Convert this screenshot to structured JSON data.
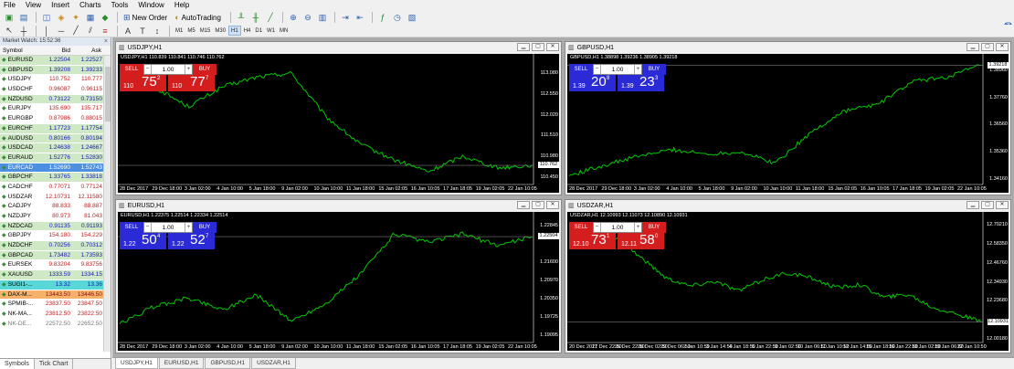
{
  "menu": [
    "File",
    "View",
    "Insert",
    "Charts",
    "Tools",
    "Window",
    "Help"
  ],
  "toolbar": {
    "new_order_label": "New Order",
    "autotrading_label": "AutoTrading",
    "timeframes": [
      "M1",
      "M5",
      "M15",
      "M30",
      "H1",
      "H4",
      "D1",
      "W1",
      "MN"
    ],
    "active_timeframe": "H1"
  },
  "market_watch": {
    "title": "Market Watch: 15:52:36",
    "headers": {
      "symbol": "Symbol",
      "bid": "Bid",
      "ask": "Ask"
    },
    "rows": [
      {
        "symbol": "EURUSD",
        "bid": "1.22504",
        "ask": "1.22527",
        "style": "green"
      },
      {
        "symbol": "GBPUSD",
        "bid": "1.39208",
        "ask": "1.39233",
        "style": "green"
      },
      {
        "symbol": "USDJPY",
        "bid": "110.752",
        "ask": "110.777",
        "style": "white"
      },
      {
        "symbol": "USDCHF",
        "bid": "0.96087",
        "ask": "0.96115",
        "style": "white"
      },
      {
        "symbol": "NZDUSD",
        "bid": "0.73122",
        "ask": "0.73150",
        "style": "green"
      },
      {
        "symbol": "EURJPY",
        "bid": "135.690",
        "ask": "135.717",
        "style": "white"
      },
      {
        "symbol": "EURGBP",
        "bid": "0.87986",
        "ask": "0.88015",
        "style": "white"
      },
      {
        "symbol": "EURCHF",
        "bid": "1.17723",
        "ask": "1.17754",
        "style": "green"
      },
      {
        "symbol": "AUDUSD",
        "bid": "0.80166",
        "ask": "0.80194",
        "style": "green"
      },
      {
        "symbol": "USDCAD",
        "bid": "1.24638",
        "ask": "1.24667",
        "style": "green"
      },
      {
        "symbol": "EURAUD",
        "bid": "1.52776",
        "ask": "1.52830",
        "style": "green"
      },
      {
        "symbol": "EURCAD",
        "bid": "1.52690",
        "ask": "1.52743",
        "style": "selected"
      },
      {
        "symbol": "GBPCHF",
        "bid": "1.33765",
        "ask": "1.33818",
        "style": "green"
      },
      {
        "symbol": "CADCHF",
        "bid": "0.77071",
        "ask": "0.77124",
        "style": "white"
      },
      {
        "symbol": "USDZAR",
        "bid": "12.10731",
        "ask": "12.11580",
        "style": "white"
      },
      {
        "symbol": "CADJPY",
        "bid": "88.833",
        "ask": "88.887",
        "style": "white"
      },
      {
        "symbol": "NZDJPY",
        "bid": "80.973",
        "ask": "81.043",
        "style": "white"
      },
      {
        "symbol": "NZDCAD",
        "bid": "0.91135",
        "ask": "0.91193",
        "style": "green"
      },
      {
        "symbol": "GBPJPY",
        "bid": "154.180",
        "ask": "154.229",
        "style": "white"
      },
      {
        "symbol": "NZDCHF",
        "bid": "0.70256",
        "ask": "0.70312",
        "style": "green"
      },
      {
        "symbol": "GBPCAD",
        "bid": "1.73482",
        "ask": "1.73593",
        "style": "green"
      },
      {
        "symbol": "EURSEK",
        "bid": "9.83204",
        "ask": "9.83756",
        "style": "white"
      },
      {
        "symbol": "XAUUSD",
        "bid": "1333.59",
        "ask": "1334.15",
        "style": "green"
      },
      {
        "symbol": "SUGI1-...",
        "bid": "13.32",
        "ask": "13.36",
        "style": "cyan"
      },
      {
        "symbol": "DAX-M...",
        "bid": "13443.50",
        "ask": "13446.50",
        "style": "orange"
      },
      {
        "symbol": "SPMIB-...",
        "bid": "23837.50",
        "ask": "23847.50",
        "style": "white"
      },
      {
        "symbol": "NK-MA...",
        "bid": "23812.50",
        "ask": "23822.50",
        "style": "white"
      },
      {
        "symbol": "NK-DE...",
        "bid": "22572.50",
        "ask": "22652.50",
        "style": "grey"
      }
    ],
    "tabs": [
      "Symbols",
      "Tick Chart"
    ]
  },
  "charts": [
    {
      "window_title": "USDJPY,H1",
      "info_line": "USDJPY,H1  110.839 110.841 110.746 110.762",
      "panel_color": "red",
      "sell_label": "SELL",
      "buy_label": "BUY",
      "volume": "1.00",
      "sell_prefix": "110",
      "sell_big": "75",
      "sell_sup": "2",
      "buy_prefix": "110",
      "buy_big": "77",
      "buy_sup": "7",
      "y_labels": [
        "113.080",
        "112.550",
        "112.020",
        "111.510",
        "110.980",
        "110.450"
      ],
      "x_labels": [
        "28 Dec 2017",
        "29 Dec 18:00",
        "3 Jan 02:00",
        "4 Jan 10:00",
        "5 Jan 18:00",
        "9 Jan 02:00",
        "10 Jan 10:00",
        "11 Jan 18:00",
        "15 Jan 02:05",
        "16 Jan 10:05",
        "17 Jan 18:05",
        "19 Jan 02:05",
        "22 Jan 10:05"
      ],
      "current_price": "110.762",
      "chart_data": {
        "type": "line",
        "x": [
          "28 Dec 2017",
          "29 Dec 18:00",
          "3 Jan 02:00",
          "4 Jan 10:00",
          "5 Jan 18:00",
          "9 Jan 02:00",
          "10 Jan 10:00",
          "11 Jan 18:00",
          "15 Jan 02:05",
          "16 Jan 10:05",
          "17 Jan 18:05",
          "19 Jan 02:05",
          "22 Jan 10:05"
        ],
        "series": [
          {
            "values": [
              112.95,
              112.75,
              112.25,
              112.75,
              113.0,
              113.1,
              112.0,
              111.3,
              110.9,
              110.6,
              111.0,
              110.7,
              110.76
            ]
          }
        ],
        "ylim": [
          110.3,
          113.4
        ]
      }
    },
    {
      "window_title": "GBPUSD,H1",
      "info_line": "GBPUSD,H1  1.38898 1.39236 1.38905 1.39218",
      "panel_color": "blue",
      "sell_label": "SELL",
      "buy_label": "BUY",
      "volume": "1.00",
      "sell_prefix": "1.39",
      "sell_big": "20",
      "sell_sup": "8",
      "buy_prefix": "1.39",
      "buy_big": "23",
      "buy_sup": "3",
      "y_labels": [
        "1.39218",
        "1.38960",
        "1.37760",
        "1.36560",
        "1.35360",
        "1.34160"
      ],
      "x_labels": [
        "28 Dec 2017",
        "29 Dec 18:00",
        "3 Jan 02:00",
        "4 Jan 10:00",
        "5 Jan 18:00",
        "9 Jan 02:00",
        "10 Jan 10:00",
        "11 Jan 18:00",
        "15 Jan 02:05",
        "16 Jan 10:05",
        "17 Jan 18:05",
        "19 Jan 02:05",
        "22 Jan 10:05"
      ],
      "current_price": "1.39218",
      "chart_data": {
        "type": "line",
        "x": [
          "28 Dec 2017",
          "29 Dec 18:00",
          "3 Jan 02:00",
          "4 Jan 10:00",
          "5 Jan 18:00",
          "9 Jan 02:00",
          "10 Jan 10:00",
          "11 Jan 18:00",
          "15 Jan 02:05",
          "16 Jan 10:05",
          "17 Jan 18:05",
          "19 Jan 02:05",
          "22 Jan 10:05"
        ],
        "series": [
          {
            "values": [
              1.3435,
              1.348,
              1.352,
              1.355,
              1.353,
              1.354,
              1.349,
              1.362,
              1.372,
              1.375,
              1.385,
              1.387,
              1.3922
            ]
          }
        ],
        "ylim": [
          1.34,
          1.394
        ]
      }
    },
    {
      "window_title": "EURUSD,H1",
      "info_line": "EURUSD,H1  1.22375 1.22514 1.22334 1.22514",
      "panel_color": "blue",
      "sell_label": "SELL",
      "buy_label": "BUY",
      "volume": "1.00",
      "sell_prefix": "1.22",
      "sell_big": "50",
      "sell_sup": "4",
      "buy_prefix": "1.22",
      "buy_big": "52",
      "buy_sup": "7",
      "y_labels": [
        "1.22845",
        "1.22504",
        "1.21600",
        "1.20970",
        "1.20350",
        "1.19725",
        "1.19095"
      ],
      "x_labels": [
        "28 Dec 2017",
        "29 Dec 18:00",
        "3 Jan 02:00",
        "4 Jan 10:00",
        "5 Jan 18:00",
        "9 Jan 02:00",
        "10 Jan 10:00",
        "11 Jan 18:00",
        "15 Jan 02:05",
        "16 Jan 10:05",
        "17 Jan 18:05",
        "19 Jan 02:05",
        "22 Jan 10:05"
      ],
      "current_price": "1.22504",
      "chart_data": {
        "type": "line",
        "x": [
          "28 Dec 2017",
          "29 Dec 18:00",
          "3 Jan 02:00",
          "4 Jan 10:00",
          "5 Jan 18:00",
          "9 Jan 02:00",
          "10 Jan 10:00",
          "11 Jan 18:00",
          "15 Jan 02:05",
          "16 Jan 10:05",
          "17 Jan 18:05",
          "19 Jan 02:05",
          "22 Jan 10:05"
        ],
        "series": [
          {
            "values": [
              1.195,
              1.201,
              1.204,
              1.2,
              1.205,
              1.196,
              1.202,
              1.212,
              1.226,
              1.223,
              1.226,
              1.222,
              1.225
            ]
          }
        ],
        "ylim": [
          1.189,
          1.231
        ]
      }
    },
    {
      "window_title": "USDZAR,H1",
      "info_line": "USDZAR,H1  12.10993 12.11073 12.10890 12.10931",
      "panel_color": "red",
      "sell_label": "SELL",
      "buy_label": "BUY",
      "volume": "1.00",
      "sell_prefix": "12.10",
      "sell_big": "73",
      "sell_sup": "1",
      "buy_prefix": "12.11",
      "buy_big": "58",
      "buy_sup": "0",
      "y_labels": [
        "12.70210",
        "12.58350",
        "12.46760",
        "12.34930",
        "12.23680",
        "12.10931",
        "12.00180"
      ],
      "x_labels": [
        "20 Dec 2017",
        "21 Dec 22:50",
        "26 Dec 22:50",
        "28 Dec 02:50",
        "29 Dec 06:50",
        "2 Jan 10:50",
        "3 Jan 14:50",
        "4 Jan 18:50",
        "5 Jan 22:50",
        "9 Jan 02:50",
        "10 Jan 06:50",
        "11 Jan 10:50",
        "12 Jan 14:50",
        "15 Jan 18:50",
        "16 Jan 22:50",
        "18 Jan 02:50",
        "19 Jan 06:50",
        "22 Jan 10:50"
      ],
      "current_price": "12.10931",
      "chart_data": {
        "type": "line",
        "x": [
          "20 Dec 2017",
          "21 Dec 22:50",
          "26 Dec 22:50",
          "28 Dec 02:50",
          "29 Dec 06:50",
          "2 Jan 10:50",
          "3 Jan 14:50",
          "4 Jan 18:50",
          "5 Jan 22:50",
          "9 Jan 02:50",
          "10 Jan 06:50",
          "11 Jan 10:50",
          "12 Jan 14:50",
          "15 Jan 18:50",
          "16 Jan 22:50",
          "18 Jan 02:50",
          "19 Jan 06:50",
          "22 Jan 10:50"
        ],
        "series": [
          {
            "values": [
              12.69,
              12.71,
              12.62,
              12.5,
              12.38,
              12.33,
              12.36,
              12.3,
              12.37,
              12.41,
              12.38,
              12.32,
              12.34,
              12.26,
              12.28,
              12.2,
              12.16,
              12.11
            ]
          }
        ],
        "ylim": [
          11.99,
          12.74
        ]
      }
    }
  ],
  "chart_tabs": [
    "USDJPY,H1",
    "EURUSD,H1",
    "GBPUSD,H1",
    "USDZAR,H1"
  ],
  "active_chart_tab": "USDJPY,H1",
  "colors": {
    "line": "#00c800",
    "sell_red": "#d41d1d",
    "sell_blue": "#2a2ad6",
    "chart_bg": "#000000"
  }
}
